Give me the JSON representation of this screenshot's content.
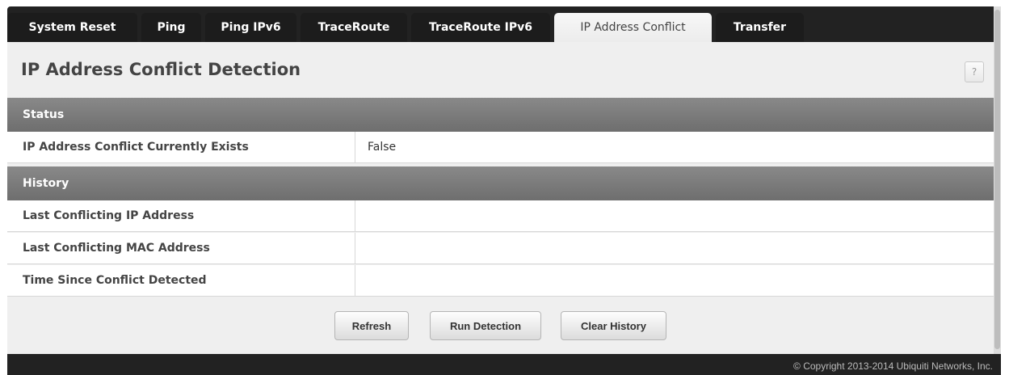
{
  "tabs": [
    {
      "label": "System Reset"
    },
    {
      "label": "Ping"
    },
    {
      "label": "Ping IPv6"
    },
    {
      "label": "TraceRoute"
    },
    {
      "label": "TraceRoute IPv6"
    },
    {
      "label": "IP Address Conflict",
      "active": true
    },
    {
      "label": "Transfer"
    }
  ],
  "page": {
    "title": "IP Address Conflict Detection",
    "help_label": "?"
  },
  "status": {
    "header": "Status",
    "conflict_label": "IP Address Conflict Currently Exists",
    "conflict_value": "False"
  },
  "history": {
    "header": "History",
    "rows": [
      {
        "label": "Last Conflicting IP Address",
        "value": ""
      },
      {
        "label": "Last Conflicting MAC Address",
        "value": ""
      },
      {
        "label": "Time Since Conflict Detected",
        "value": ""
      }
    ]
  },
  "buttons": {
    "refresh": "Refresh",
    "run_detection": "Run Detection",
    "clear_history": "Clear History"
  },
  "footer": {
    "copyright": "© Copyright 2013-2014 Ubiquiti Networks, Inc."
  }
}
